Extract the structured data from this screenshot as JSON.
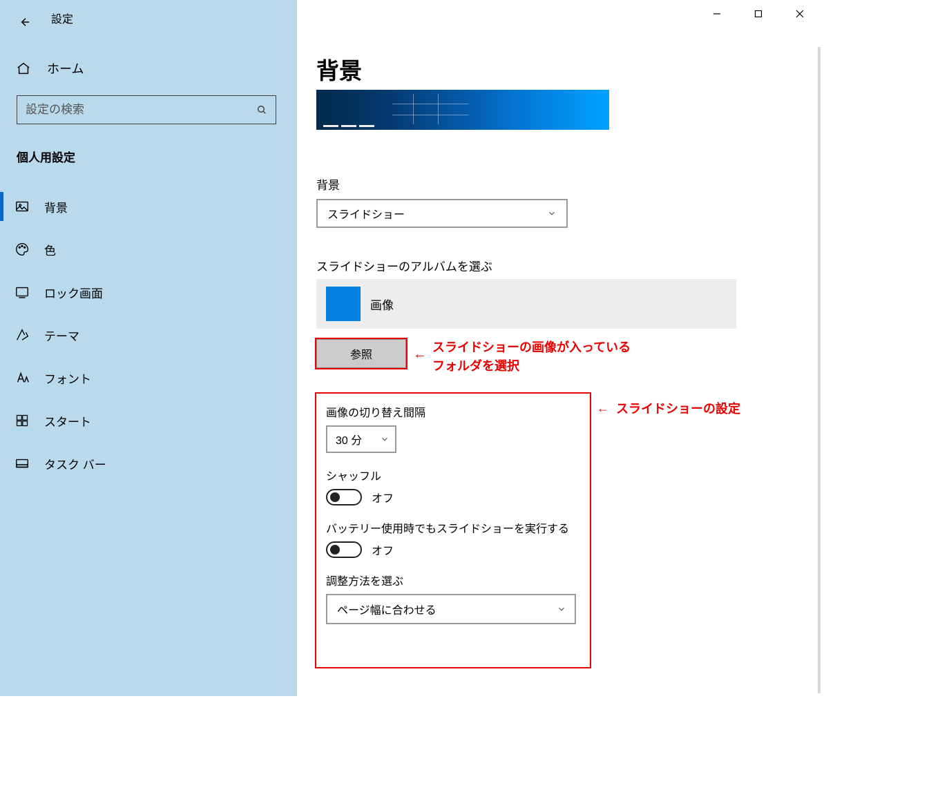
{
  "app_title": "設定",
  "page_heading": "背景",
  "search": {
    "placeholder": "設定の検索"
  },
  "home_label": "ホーム",
  "category_title": "個人用設定",
  "nav": {
    "items": [
      {
        "label": "背景",
        "icon": "picture-icon",
        "active": true
      },
      {
        "label": "色",
        "icon": "palette-icon",
        "active": false
      },
      {
        "label": "ロック画面",
        "icon": "lockscreen-icon",
        "active": false
      },
      {
        "label": "テーマ",
        "icon": "theme-icon",
        "active": false
      },
      {
        "label": "フォント",
        "icon": "font-icon",
        "active": false
      },
      {
        "label": "スタート",
        "icon": "start-icon",
        "active": false
      },
      {
        "label": "タスク バー",
        "icon": "taskbar-icon",
        "active": false
      }
    ]
  },
  "background": {
    "label": "背景",
    "dropdown_value": "スライドショー"
  },
  "album": {
    "label": "スライドショーのアルバムを選ぶ",
    "name": "画像"
  },
  "browse_button": "参照",
  "annotations": {
    "browse": "スライドショーの画像が入っている\nフォルダを選択",
    "slideshow_box": "スライドショーの設定"
  },
  "slideshow": {
    "interval_label": "画像の切り替え間隔",
    "interval_value": "30 分",
    "shuffle_label": "シャッフル",
    "shuffle_value": "オフ",
    "battery_label": "バッテリー使用時でもスライドショーを実行する",
    "battery_value": "オフ",
    "fit_label": "調整方法を選ぶ",
    "fit_value": "ページ幅に合わせる"
  }
}
